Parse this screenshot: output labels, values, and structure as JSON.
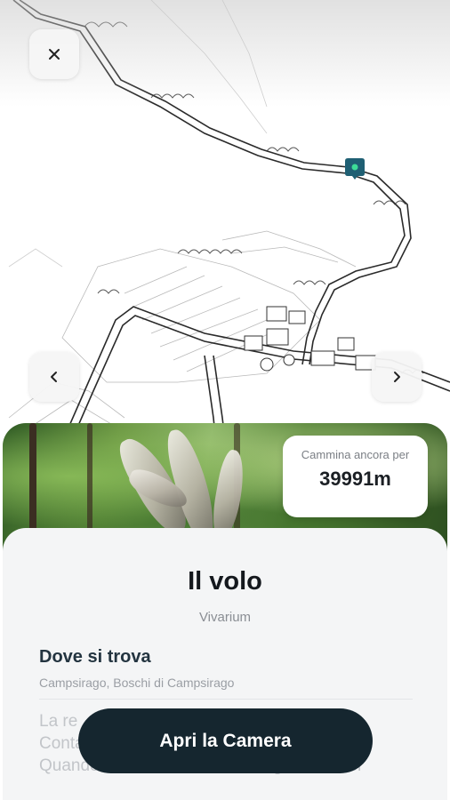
{
  "map": {
    "marker_color": "#1f5f73",
    "marker_dot_color": "#3ddc97"
  },
  "controls": {
    "close_icon": "close-icon",
    "prev_icon": "chevron-left-icon",
    "next_icon": "chevron-right-icon"
  },
  "walk": {
    "label": "Cammina ancora per",
    "value": "39991m"
  },
  "detail": {
    "title": "Il volo",
    "subtitle": "Vivarium",
    "location_heading": "Dove si trova",
    "location_text": "Campsirago, Boschi di Campsirago",
    "body_line1": "La re",
    "body_line2": "Conta",
    "body_line3": "Quando avrai finito, vedrai con gli occhi del"
  },
  "cta": {
    "label": "Apri la Camera"
  },
  "colors": {
    "accent": "#15262f",
    "heading": "#233440"
  }
}
